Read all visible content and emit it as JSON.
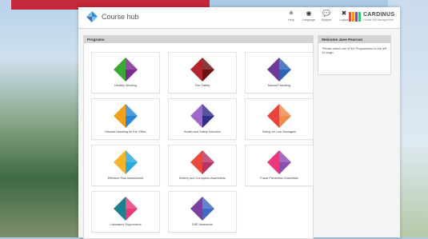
{
  "promo": {
    "text": ""
  },
  "header": {
    "app_title": "Course hub",
    "tools": [
      {
        "icon": "help-icon",
        "glyph": "✳",
        "label": "Help"
      },
      {
        "icon": "language-icon",
        "glyph": "◉",
        "label": "Language"
      },
      {
        "icon": "support-icon",
        "glyph": "💬",
        "label": "Support"
      },
      {
        "icon": "logout-icon",
        "glyph": "✖",
        "label": "Logout"
      }
    ],
    "brand": {
      "name": "CARDINUS",
      "sub": "Global risk management",
      "bar_colors": [
        "#e84b3c",
        "#f39c12",
        "#8e44ad",
        "#2ecc71"
      ]
    }
  },
  "programmes": {
    "title": "Programs",
    "courses": [
      {
        "name": "Healthy Working",
        "c1": "#3aaa35",
        "c2": "#7b2a8f"
      },
      {
        "name": "Fire Safety",
        "c1": "#b3242c",
        "c2": "#6d1015"
      },
      {
        "name": "Manual Handling",
        "c1": "#6d3a9a",
        "c2": "#2a64b5"
      },
      {
        "name": "Manual Handling for the Office",
        "c1": "#f3a01b",
        "c2": "#2a86d6"
      },
      {
        "name": "Health and Safety Induction",
        "c1": "#9b6bc9",
        "c2": "#2f2f8a"
      },
      {
        "name": "Safety for Line Managers",
        "c1": "#e8433c",
        "c2": "#f08b4b"
      },
      {
        "name": "Effective Risk Assessment",
        "c1": "#f5b52a",
        "c2": "#2aa8e0"
      },
      {
        "name": "Bribery and Corruption Awareness",
        "c1": "#e84a3c",
        "c2": "#b83468"
      },
      {
        "name": "Fraud Prevention Essentials",
        "c1": "#e9397c",
        "c2": "#8a4fb0"
      },
      {
        "name": "Laboratory Ergonomics",
        "c1": "#1e7f8f",
        "c2": "#e53978"
      },
      {
        "name": "DSE Assessors",
        "c1": "#7b3fa0",
        "c2": "#3c6bc4"
      }
    ]
  },
  "welcome": {
    "title": "Welcome Jane Pearson",
    "message": "Please select one of the Programmes to the left to begin."
  }
}
